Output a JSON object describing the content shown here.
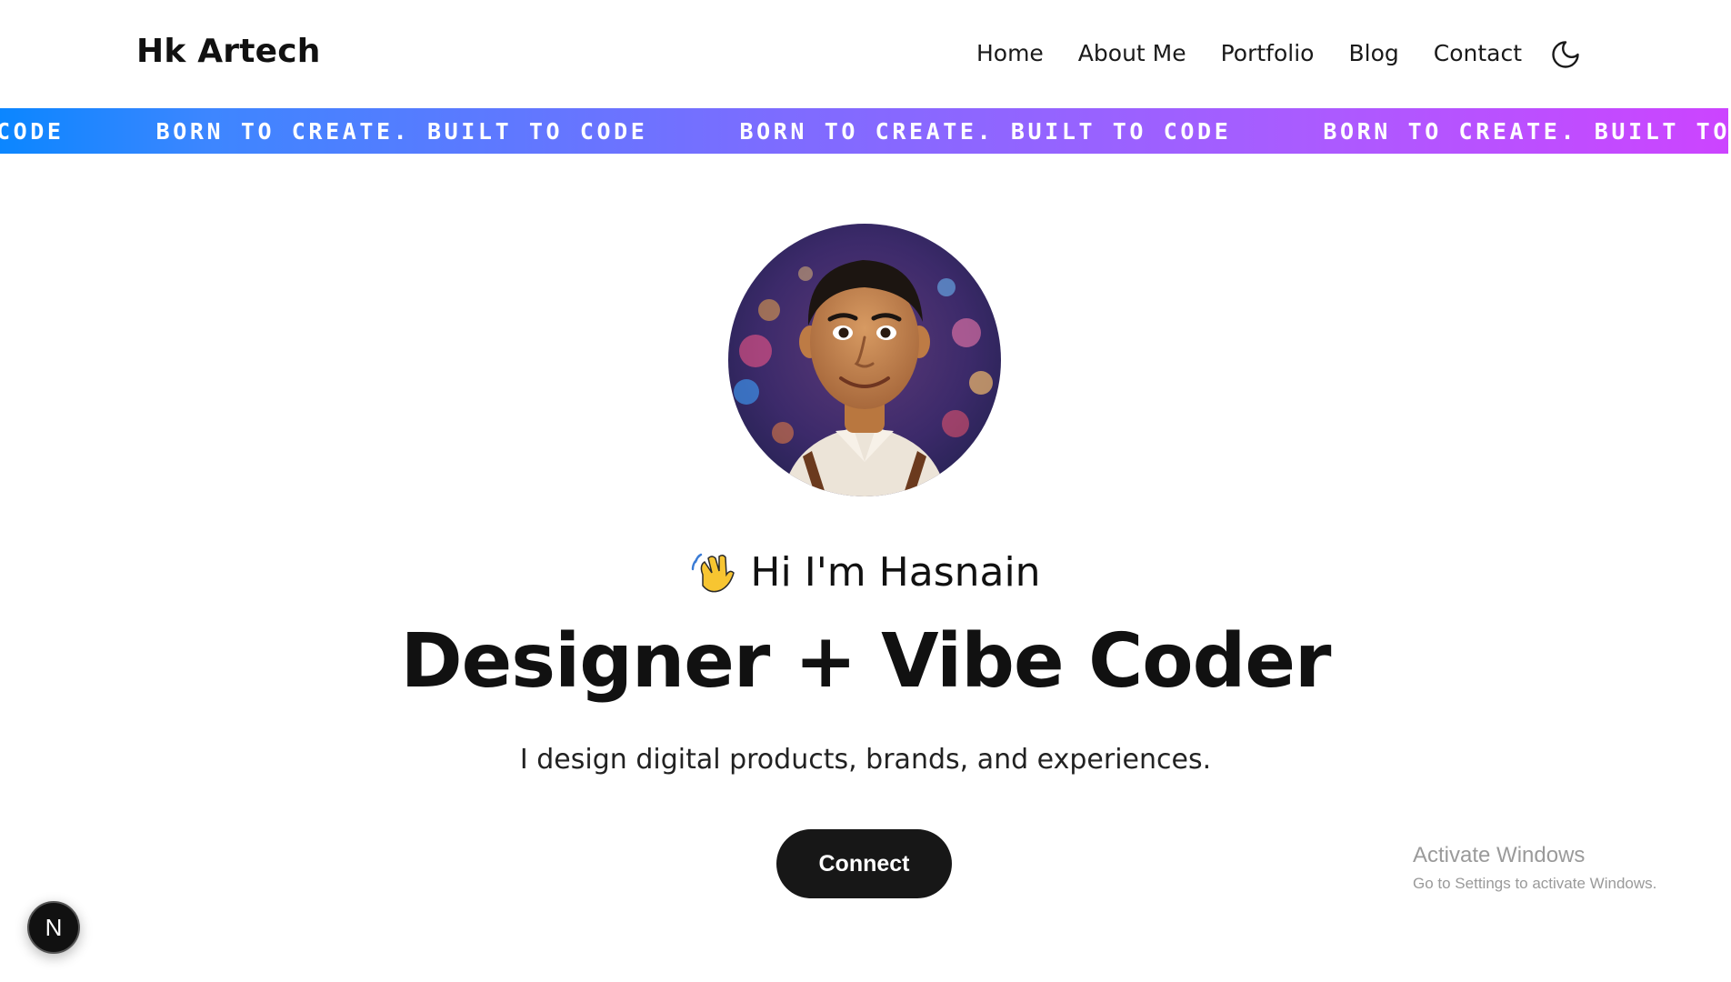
{
  "header": {
    "brand": "Hk Artech",
    "nav": [
      {
        "label": "Home"
      },
      {
        "label": "About Me"
      },
      {
        "label": "Portfolio"
      },
      {
        "label": "Blog"
      },
      {
        "label": "Contact"
      }
    ],
    "theme_toggle_icon": "moon-icon"
  },
  "marquee": {
    "items": [
      "TO CODE",
      "BORN TO CREATE. BUILT TO CODE",
      "BORN TO CREATE. BUILT TO CODE",
      "BORN TO CREATE. BUILT TO CODE"
    ],
    "gradient_start": "#0b86ff",
    "gradient_end": "#cc44ff"
  },
  "hero": {
    "greeting_emoji_icon": "waving-hand-icon",
    "greeting": "Hi I'm Hasnain",
    "headline": "Designer + Vibe Coder",
    "subheadline": "I design digital products, brands, and experiences.",
    "cta_label": "Connect"
  },
  "watermark": {
    "title": "Activate Windows",
    "subtitle": "Go to Settings to activate Windows."
  },
  "dev_badge": {
    "label": "N"
  }
}
